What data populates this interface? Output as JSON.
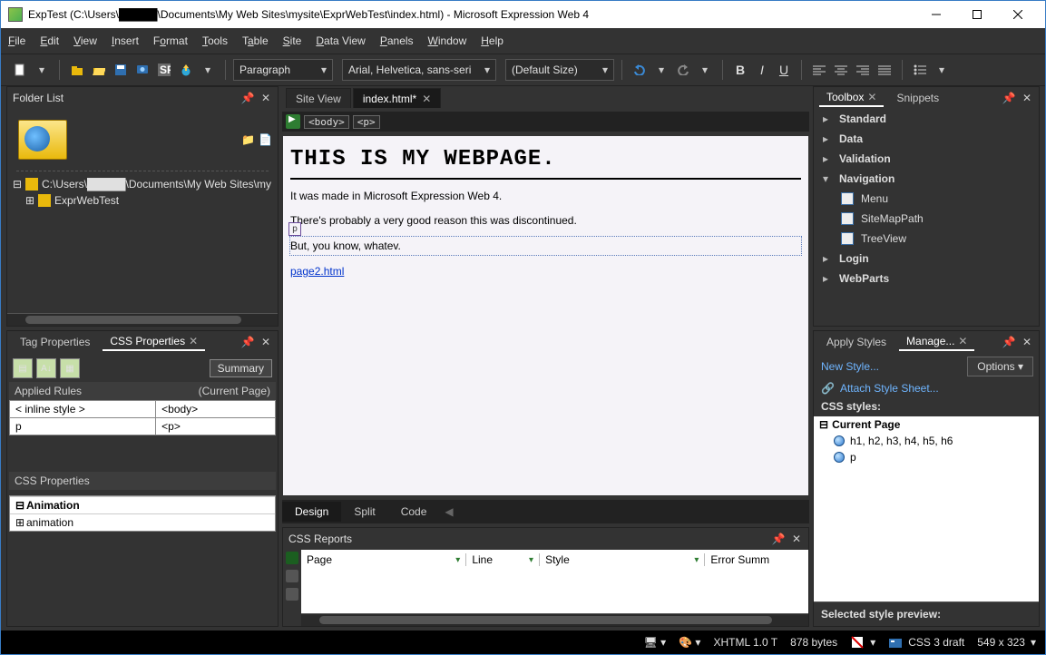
{
  "window": {
    "title": "ExpTest (C:\\Users\\█████\\Documents\\My Web Sites\\mysite\\ExprWebTest\\index.html) - Microsoft Expression Web 4"
  },
  "menu": {
    "items": [
      "File",
      "Edit",
      "View",
      "Insert",
      "Format",
      "Tools",
      "Table",
      "Site",
      "Data View",
      "Panels",
      "Window",
      "Help"
    ]
  },
  "toolbar": {
    "style_combo": "Paragraph",
    "font_combo": "Arial, Helvetica, sans-seri",
    "size_combo": "(Default Size)"
  },
  "folder_list": {
    "title": "Folder List",
    "path_row": "C:\\Users\\█████\\Documents\\My Web Sites\\my",
    "child": "ExprWebTest"
  },
  "tag_props": {
    "tab1": "Tag Properties",
    "tab2": "CSS Properties",
    "summary": "Summary",
    "applied_rules": "Applied Rules",
    "current_page": "(Current Page)",
    "rule_rows": [
      [
        "< inline style >",
        "<body>"
      ],
      [
        "p",
        "<p>"
      ]
    ],
    "css_props_label": "CSS Properties",
    "category1": "Animation",
    "prop1": "animation"
  },
  "editor": {
    "tabs": {
      "site_view": "Site View",
      "file": "index.html*"
    },
    "breadcrumb": [
      "<body>",
      "<p>"
    ],
    "content": {
      "h1": "THIS IS MY WEBPAGE.",
      "p1": "It was made in Microsoft Expression Web 4.",
      "p2": "There's probably a very good reason this was discontinued.",
      "sel_tag": "p",
      "p3": "But, you know, whatev.",
      "link": "page2.html"
    },
    "view_modes": [
      "Design",
      "Split",
      "Code"
    ]
  },
  "css_reports": {
    "title": "CSS Reports",
    "cols": [
      "Page",
      "Line",
      "Style",
      "Error Summ"
    ]
  },
  "toolbox": {
    "tab1": "Toolbox",
    "tab2": "Snippets",
    "groups": {
      "standard": "Standard",
      "data": "Data",
      "validation": "Validation",
      "navigation": "Navigation",
      "nav_items": [
        "Menu",
        "SiteMapPath",
        "TreeView"
      ],
      "login": "Login",
      "webparts": "WebParts"
    }
  },
  "styles_panel": {
    "tab1": "Apply Styles",
    "tab2": "Manage...",
    "new_style": "New Style...",
    "options": "Options",
    "attach": "Attach Style Sheet...",
    "heading": "CSS styles:",
    "group": "Current Page",
    "rules": [
      "h1, h2, h3, h4, h5, h6",
      "p"
    ],
    "preview": "Selected style preview:"
  },
  "status": {
    "doctype": "XHTML 1.0 T",
    "size": "878 bytes",
    "css": "CSS 3 draft",
    "dim": "549 x 323"
  }
}
